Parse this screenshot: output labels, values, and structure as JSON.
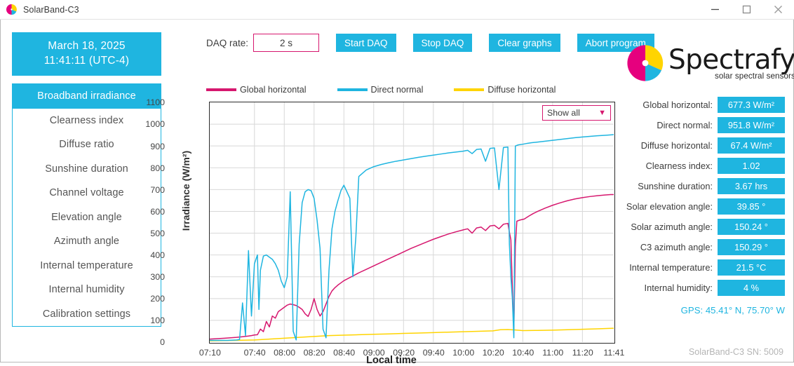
{
  "window": {
    "title": "SolarBand-C3",
    "app_icon": "spectrafy-logo-icon",
    "minimize_label": "Minimize",
    "maximize_label": "Maximize",
    "close_label": "Close"
  },
  "sidebar": {
    "clock": {
      "date": "March 18, 2025",
      "time": "11:41:11 (UTC-4)"
    },
    "items": [
      {
        "label": "Broadband irradiance",
        "active": true
      },
      {
        "label": "Clearness index",
        "active": false
      },
      {
        "label": "Diffuse ratio",
        "active": false
      },
      {
        "label": "Sunshine duration",
        "active": false
      },
      {
        "label": "Channel voltage",
        "active": false
      },
      {
        "label": "Elevation angle",
        "active": false
      },
      {
        "label": "Azimuth angle",
        "active": false
      },
      {
        "label": "Internal temperature",
        "active": false
      },
      {
        "label": "Internal humidity",
        "active": false
      },
      {
        "label": "Calibration settings",
        "active": false
      }
    ]
  },
  "toolbar": {
    "daq_rate_label": "DAQ rate:",
    "daq_rate_value": "2 s",
    "start_label": "Start DAQ",
    "stop_label": "Stop DAQ",
    "clear_label": "Clear graphs",
    "abort_label": "Abort program"
  },
  "chart_filter": {
    "selected": "Show all",
    "caret_icon": "chevron-down-icon"
  },
  "readouts": [
    {
      "label": "Global horizontal:",
      "value": "677.3 W/m²"
    },
    {
      "label": "Direct normal:",
      "value": "951.8 W/m²"
    },
    {
      "label": "Diffuse horizontal:",
      "value": "67.4 W/m²"
    },
    {
      "label": "Clearness index:",
      "value": "1.02"
    },
    {
      "label": "Sunshine duration:",
      "value": "3.67 hrs"
    },
    {
      "label": "Solar elevation angle:",
      "value": "39.85 °"
    },
    {
      "label": "Solar azimuth angle:",
      "value": "150.24 °"
    },
    {
      "label": "C3 azimuth angle:",
      "value": "150.29 °"
    },
    {
      "label": "Internal temperature:",
      "value": "21.5 °C"
    },
    {
      "label": "Internal humidity:",
      "value": "4 %"
    }
  ],
  "gps": "GPS: 45.41° N, 75.70° W",
  "serial": "SolarBand-C3 SN: 5009",
  "brand": {
    "word": "Spectrafy",
    "tagline": "solar spectral sensors",
    "color_magenta": "#e6007e",
    "color_yellow": "#ffd400",
    "color_cyan": "#1fb5e0"
  },
  "chart_data": {
    "type": "line",
    "title": "",
    "xlabel": "Local time",
    "ylabel": "Irradiance (W/m²)",
    "ylim": [
      0,
      1100
    ],
    "yticks": [
      0,
      100,
      200,
      300,
      400,
      500,
      600,
      700,
      800,
      900,
      1000,
      1100
    ],
    "grid": true,
    "legend_position": "top",
    "xticks": [
      "07:10",
      "07:40",
      "08:00",
      "08:20",
      "08:40",
      "09:00",
      "09:20",
      "09:40",
      "10:00",
      "10:20",
      "10:40",
      "11:00",
      "11:20",
      "11:41"
    ],
    "xtick_minutes": [
      430,
      460,
      480,
      500,
      520,
      540,
      560,
      580,
      600,
      620,
      640,
      660,
      680,
      701
    ],
    "xlim_minutes": [
      430,
      701
    ],
    "series": [
      {
        "name": "Global horizontal",
        "color": "#d6176e",
        "x": [
          430,
          440,
          448,
          452,
          456,
          458,
          460,
          462,
          464,
          466,
          468,
          470,
          472,
          474,
          476,
          478,
          480,
          482,
          484,
          486,
          488,
          490,
          492,
          494,
          496,
          498,
          500,
          502,
          504,
          506,
          508,
          510,
          512,
          514,
          516,
          518,
          520,
          525,
          530,
          535,
          540,
          545,
          550,
          555,
          560,
          565,
          570,
          575,
          580,
          585,
          590,
          595,
          600,
          603,
          606,
          609,
          612,
          615,
          618,
          621,
          624,
          627,
          630,
          631,
          632,
          633,
          634,
          635,
          636,
          638,
          641,
          644,
          647,
          650,
          655,
          660,
          665,
          670,
          675,
          680,
          685,
          690,
          695,
          699,
          701
        ],
        "y": [
          14,
          18,
          22,
          25,
          28,
          30,
          33,
          34,
          60,
          48,
          95,
          70,
          120,
          110,
          140,
          150,
          160,
          170,
          175,
          172,
          168,
          160,
          150,
          130,
          118,
          150,
          200,
          150,
          120,
          140,
          175,
          210,
          235,
          250,
          262,
          272,
          282,
          300,
          318,
          334,
          350,
          366,
          382,
          398,
          414,
          430,
          444,
          458,
          472,
          484,
          496,
          506,
          515,
          520,
          500,
          524,
          528,
          512,
          533,
          536,
          520,
          541,
          545,
          505,
          470,
          250,
          60,
          440,
          555,
          560,
          565,
          578,
          590,
          600,
          615,
          628,
          639,
          649,
          657,
          663,
          668,
          672,
          675,
          677,
          677
        ]
      },
      {
        "name": "Direct normal",
        "color": "#1fb5e0",
        "x": [
          430,
          442,
          448,
          450,
          452,
          454,
          456,
          458,
          460,
          462,
          463,
          464,
          466,
          468,
          470,
          472,
          474,
          476,
          478,
          480,
          482,
          484,
          486,
          488,
          490,
          492,
          494,
          496,
          498,
          500,
          502,
          504,
          506,
          508,
          510,
          512,
          514,
          516,
          518,
          520,
          522,
          524,
          526,
          528,
          530,
          535,
          540,
          545,
          550,
          555,
          560,
          565,
          570,
          575,
          580,
          585,
          590,
          595,
          600,
          603,
          606,
          609,
          612,
          615,
          618,
          621,
          624,
          627,
          630,
          631,
          632,
          633,
          634,
          635,
          637,
          640,
          643,
          646,
          650,
          655,
          660,
          665,
          670,
          675,
          680,
          685,
          690,
          695,
          699,
          701
        ],
        "y": [
          8,
          8,
          10,
          12,
          180,
          30,
          420,
          120,
          360,
          400,
          150,
          330,
          395,
          400,
          390,
          380,
          360,
          330,
          280,
          250,
          300,
          690,
          50,
          10,
          450,
          640,
          690,
          700,
          695,
          660,
          560,
          430,
          60,
          20,
          330,
          520,
          600,
          650,
          695,
          720,
          690,
          660,
          300,
          480,
          760,
          790,
          805,
          815,
          823,
          830,
          836,
          842,
          848,
          853,
          858,
          863,
          868,
          872,
          876,
          880,
          865,
          884,
          886,
          830,
          889,
          891,
          700,
          893,
          895,
          450,
          300,
          200,
          20,
          900,
          905,
          908,
          912,
          915,
          918,
          922,
          926,
          930,
          934,
          938,
          941,
          944,
          947,
          949,
          951,
          952
        ]
      },
      {
        "name": "Diffuse horizontal",
        "color": "#ffd400",
        "color_note": "yellow",
        "x": [
          430,
          460,
          470,
          480,
          490,
          500,
          510,
          520,
          530,
          540,
          550,
          560,
          570,
          580,
          590,
          600,
          610,
          620,
          625,
          630,
          635,
          640,
          650,
          660,
          670,
          680,
          690,
          701
        ],
        "y": [
          6,
          10,
          14,
          18,
          22,
          26,
          30,
          32,
          34,
          36,
          38,
          40,
          42,
          44,
          46,
          48,
          50,
          52,
          57,
          58,
          56,
          53,
          54,
          55,
          57,
          59,
          61,
          64
        ]
      }
    ]
  }
}
